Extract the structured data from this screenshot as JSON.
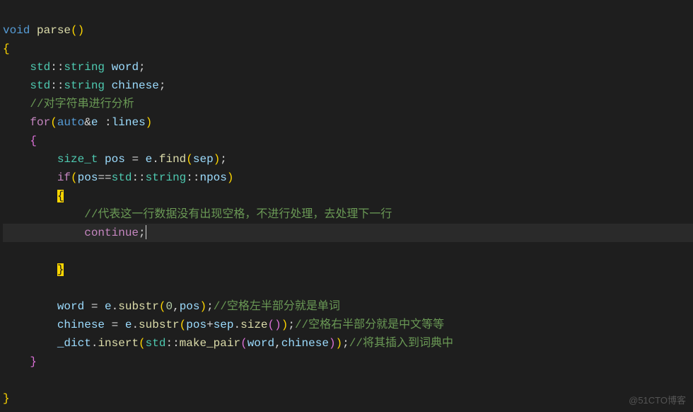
{
  "code": {
    "line1": {
      "void": "void",
      "parse": "parse",
      "parens": "()"
    },
    "line2": "{",
    "line3": {
      "std": "std",
      "dcolon": "::",
      "string": "string",
      "word": " word",
      "semi": ";"
    },
    "line4": {
      "std": "std",
      "dcolon": "::",
      "string": "string",
      "chinese": " chinese",
      "semi": ";"
    },
    "line5": "//对字符串进行分析",
    "line6": {
      "for": "for",
      "lparen": "(",
      "auto": "auto",
      "amp": "&",
      "e": "e ",
      "colon": ":",
      "lines": "lines",
      "rparen": ")"
    },
    "line7": "{",
    "line8": {
      "size_t": "size_t",
      "pos": " pos ",
      "eq": "=",
      "e": " e",
      "dot": ".",
      "find": "find",
      "lparen": "(",
      "sep": "sep",
      "rparen": ")",
      "semi": ";"
    },
    "line9": {
      "if": "if",
      "lparen": "(",
      "pos": "pos",
      "eqeq": "==",
      "std": "std",
      "dcolon1": "::",
      "string": "string",
      "dcolon2": "::",
      "npos": "npos",
      "rparen": ")"
    },
    "line10": "{",
    "line11": "//代表这一行数据没有出现空格，不进行处理，去处理下一行",
    "line12": {
      "continue": "continue",
      "semi": ";"
    },
    "line13": "}",
    "line14": {
      "word": "word ",
      "eq": "=",
      "e": " e",
      "dot": ".",
      "substr": "substr",
      "lparen": "(",
      "zero": "0",
      "comma": ",",
      "pos": "pos",
      "rparen": ")",
      "semi": ";",
      "comment": "//空格左半部分就是单词"
    },
    "line15": {
      "chinese": "chinese ",
      "eq": "=",
      "e": " e",
      "dot": ".",
      "substr": "substr",
      "lparen": "(",
      "pos": "pos",
      "plus": "+",
      "sep": "sep",
      "dot2": ".",
      "size": "size",
      "lparen2": "(",
      "rparen2": ")",
      "rparen": ")",
      "semi": ";",
      "comment": "//空格右半部分就是中文等等"
    },
    "line16": {
      "dict": "_dict",
      "dot": ".",
      "insert": "insert",
      "lparen": "(",
      "std": "std",
      "dcolon": "::",
      "make_pair": "make_pair",
      "lparen2": "(",
      "word": "word",
      "comma": ",",
      "chinese": "chinese",
      "rparen2": ")",
      "rparen": ")",
      "semi": ";",
      "comment": "//将其插入到词典中"
    },
    "line17": "}",
    "line18": "}"
  },
  "watermark": "@51CTO博客"
}
